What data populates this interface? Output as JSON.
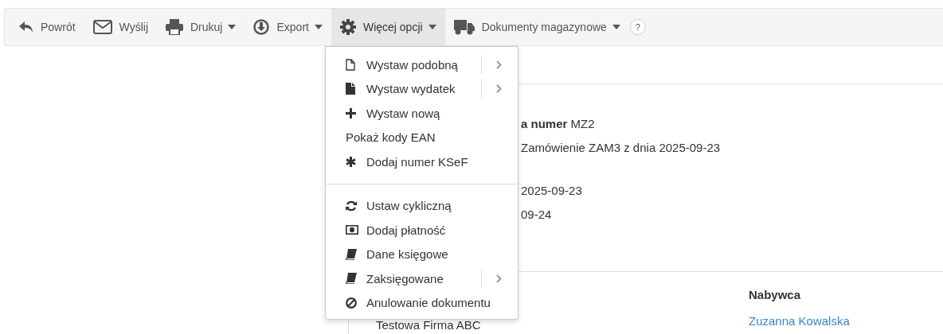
{
  "toolbar": {
    "items": [
      {
        "label": "Powrót",
        "dropdown": false,
        "selected": false
      },
      {
        "label": "Wyślij",
        "dropdown": false,
        "selected": false
      },
      {
        "label": "Drukuj",
        "dropdown": true,
        "selected": false
      },
      {
        "label": "Export",
        "dropdown": true,
        "selected": false
      },
      {
        "label": "Więcej opcji",
        "dropdown": true,
        "selected": true
      },
      {
        "label": "Dokumenty magazynowe",
        "dropdown": true,
        "selected": false
      }
    ],
    "help": "?"
  },
  "menu": {
    "groups": [
      [
        {
          "label": "Wystaw podobną",
          "submenu": true
        },
        {
          "label": "Wystaw wydatek",
          "submenu": true
        },
        {
          "label": "Wystaw nową",
          "submenu": false
        },
        {
          "label": "Pokaż kody EAN",
          "submenu": false
        },
        {
          "label": "Dodaj numer KSeF",
          "submenu": false
        }
      ],
      [
        {
          "label": "Ustaw cykliczną",
          "submenu": false
        },
        {
          "label": "Dodaj płatność",
          "submenu": false
        },
        {
          "label": "Dane księgowe",
          "submenu": false
        },
        {
          "label": "Zaksięgowane",
          "submenu": true
        },
        {
          "label": "Anulowanie dokumentu",
          "submenu": false
        }
      ]
    ]
  },
  "document": {
    "lines": [
      "**a numer** MZ2",
      "Zamówienie ZAM3 z dnia 2025-09-23",
      "2025-09-23",
      "09-24"
    ],
    "seller_name": "Testowa Firma ABC",
    "buyer_heading": "Nabywca",
    "buyer_name": "Zuzanna Kowalska"
  }
}
